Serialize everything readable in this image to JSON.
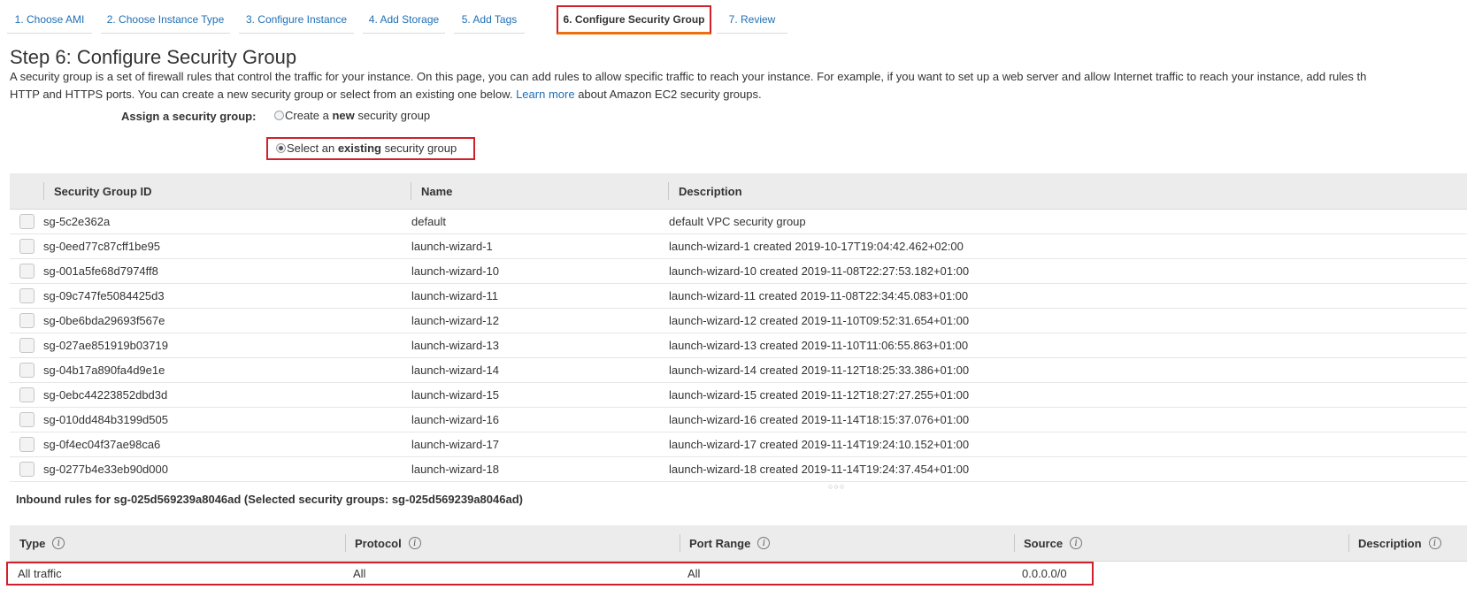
{
  "wizard": {
    "tabs": [
      {
        "label": "1. Choose AMI"
      },
      {
        "label": "2. Choose Instance Type"
      },
      {
        "label": "3. Configure Instance"
      },
      {
        "label": "4. Add Storage"
      },
      {
        "label": "5. Add Tags"
      },
      {
        "label": "6. Configure Security Group"
      },
      {
        "label": "7. Review"
      }
    ],
    "active_tab": "6. Configure Security Group"
  },
  "page": {
    "title": "Step 6: Configure Security Group",
    "description_line1": "A security group is a set of firewall rules that control the traffic for your instance. On this page, you can add rules to allow specific traffic to reach your instance. For example, if you want to set up a web server and allow Internet traffic to reach your instance, add rules th",
    "description_line2_prefix": "HTTP and HTTPS ports. You can create a new security group or select from an existing one below.",
    "learn_more": "Learn more",
    "description_line2_suffix": "about Amazon EC2 security groups."
  },
  "assign": {
    "label": "Assign a security group:",
    "option_new_pre": "Create a ",
    "option_new_bold": "new",
    "option_new_post": " security group",
    "option_existing_pre": "Select an ",
    "option_existing_bold": "existing",
    "option_existing_post": " security group",
    "selected": "existing"
  },
  "security_groups": {
    "columns": [
      "Security Group ID",
      "Name",
      "Description"
    ],
    "rows": [
      {
        "id": "sg-5c2e362a",
        "name": "default",
        "description": "default VPC security group"
      },
      {
        "id": "sg-0eed77c87cff1be95",
        "name": "launch-wizard-1",
        "description": "launch-wizard-1 created 2019-10-17T19:04:42.462+02:00"
      },
      {
        "id": "sg-001a5fe68d7974ff8",
        "name": "launch-wizard-10",
        "description": "launch-wizard-10 created 2019-11-08T22:27:53.182+01:00"
      },
      {
        "id": "sg-09c747fe5084425d3",
        "name": "launch-wizard-11",
        "description": "launch-wizard-11 created 2019-11-08T22:34:45.083+01:00"
      },
      {
        "id": "sg-0be6bda29693f567e",
        "name": "launch-wizard-12",
        "description": "launch-wizard-12 created 2019-11-10T09:52:31.654+01:00"
      },
      {
        "id": "sg-027ae851919b03719",
        "name": "launch-wizard-13",
        "description": "launch-wizard-13 created 2019-11-10T11:06:55.863+01:00"
      },
      {
        "id": "sg-04b17a890fa4d9e1e",
        "name": "launch-wizard-14",
        "description": "launch-wizard-14 created 2019-11-12T18:25:33.386+01:00"
      },
      {
        "id": "sg-0ebc44223852dbd3d",
        "name": "launch-wizard-15",
        "description": "launch-wizard-15 created 2019-11-12T18:27:27.255+01:00"
      },
      {
        "id": "sg-010dd484b3199d505",
        "name": "launch-wizard-16",
        "description": "launch-wizard-16 created 2019-11-14T18:15:37.076+01:00"
      },
      {
        "id": "sg-0f4ec04f37ae98ca6",
        "name": "launch-wizard-17",
        "description": "launch-wizard-17 created 2019-11-14T19:24:10.152+01:00"
      },
      {
        "id": "sg-0277b4e33eb90d000",
        "name": "launch-wizard-18",
        "description": "launch-wizard-18 created 2019-11-14T19:24:37.454+01:00"
      }
    ]
  },
  "inbound": {
    "title": "Inbound rules for sg-025d569239a8046ad (Selected security groups: sg-025d569239a8046ad)",
    "columns": [
      "Type",
      "Protocol",
      "Port Range",
      "Source",
      "Description"
    ],
    "rows": [
      {
        "type": "All traffic",
        "protocol": "All",
        "port_range": "All",
        "source": "0.0.0.0/0",
        "description": ""
      }
    ]
  },
  "colors": {
    "link": "#1f6fb5",
    "highlight_border": "#d0202a",
    "active_tab_underline": "#ec7211",
    "table_header_bg": "#ececec"
  }
}
